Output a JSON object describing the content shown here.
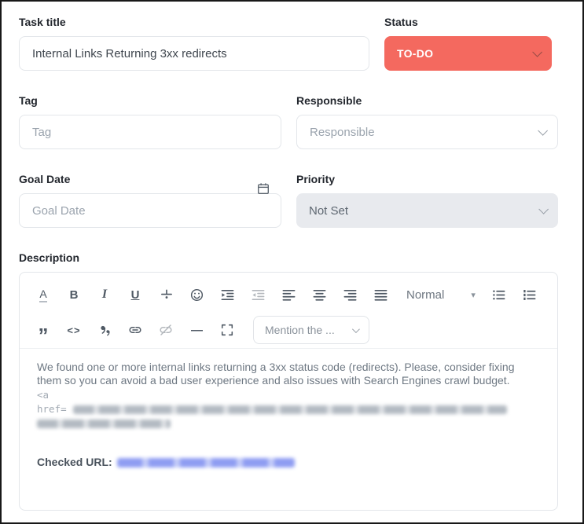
{
  "form": {
    "task_title": {
      "label": "Task title",
      "value": "Internal Links Returning 3xx redirects"
    },
    "status": {
      "label": "Status",
      "value": "TO-DO",
      "color": "#f4695f"
    },
    "tag": {
      "label": "Tag",
      "placeholder": "Tag"
    },
    "responsible": {
      "label": "Responsible",
      "placeholder": "Responsible"
    },
    "goal_date": {
      "label": "Goal Date",
      "placeholder": "Goal Date"
    },
    "priority": {
      "label": "Priority",
      "value": "Not Set"
    },
    "description_label": "Description"
  },
  "editor": {
    "toolbar": {
      "format_label": "Normal",
      "format_caret": "▾",
      "mention_label": "Mention the ...",
      "glyphs": {
        "font_color": "A",
        "bold": "B",
        "italic": "I",
        "underline": "U",
        "code": "<>",
        "blockquote": "”",
        "horizontal_rule": "—"
      },
      "row1_icons": [
        "font-color",
        "bold",
        "italic",
        "underline",
        "strikethrough",
        "emoji",
        "indent",
        "outdent",
        "align-left",
        "align-center",
        "align-right",
        "align-justify",
        "paragraph-format",
        "unordered-list",
        "ordered-list"
      ],
      "row2_icons": [
        "blockquote",
        "code",
        "special-characters",
        "link",
        "unlink",
        "horizontal-rule",
        "fullscreen",
        "mention"
      ]
    },
    "content": {
      "paragraph": "We found one or more internal links returning a 3xx status code (redirects). Please, consider fixing them so you can avoid a bad user experience and also issues with Search Engines crawl budget.",
      "code_open": "<a",
      "code_href_prefix": "href=",
      "checked_url_label": "Checked URL:"
    }
  },
  "colors": {
    "status_red": "#f4695f",
    "priority_bg": "#e8eaee",
    "link_blue": "#8c9bf3"
  }
}
